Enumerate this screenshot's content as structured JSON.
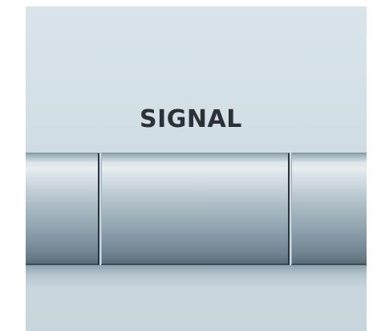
{
  "panel": {
    "label": "SIGNAL"
  },
  "colors": {
    "background": "#d2dee5",
    "label_text": "#2c3136",
    "key_top": "#e4ebef",
    "key_bottom": "#5b6c78",
    "divider": "#2b343b"
  },
  "keys": [
    {
      "id": "left"
    },
    {
      "id": "center"
    },
    {
      "id": "right"
    }
  ]
}
